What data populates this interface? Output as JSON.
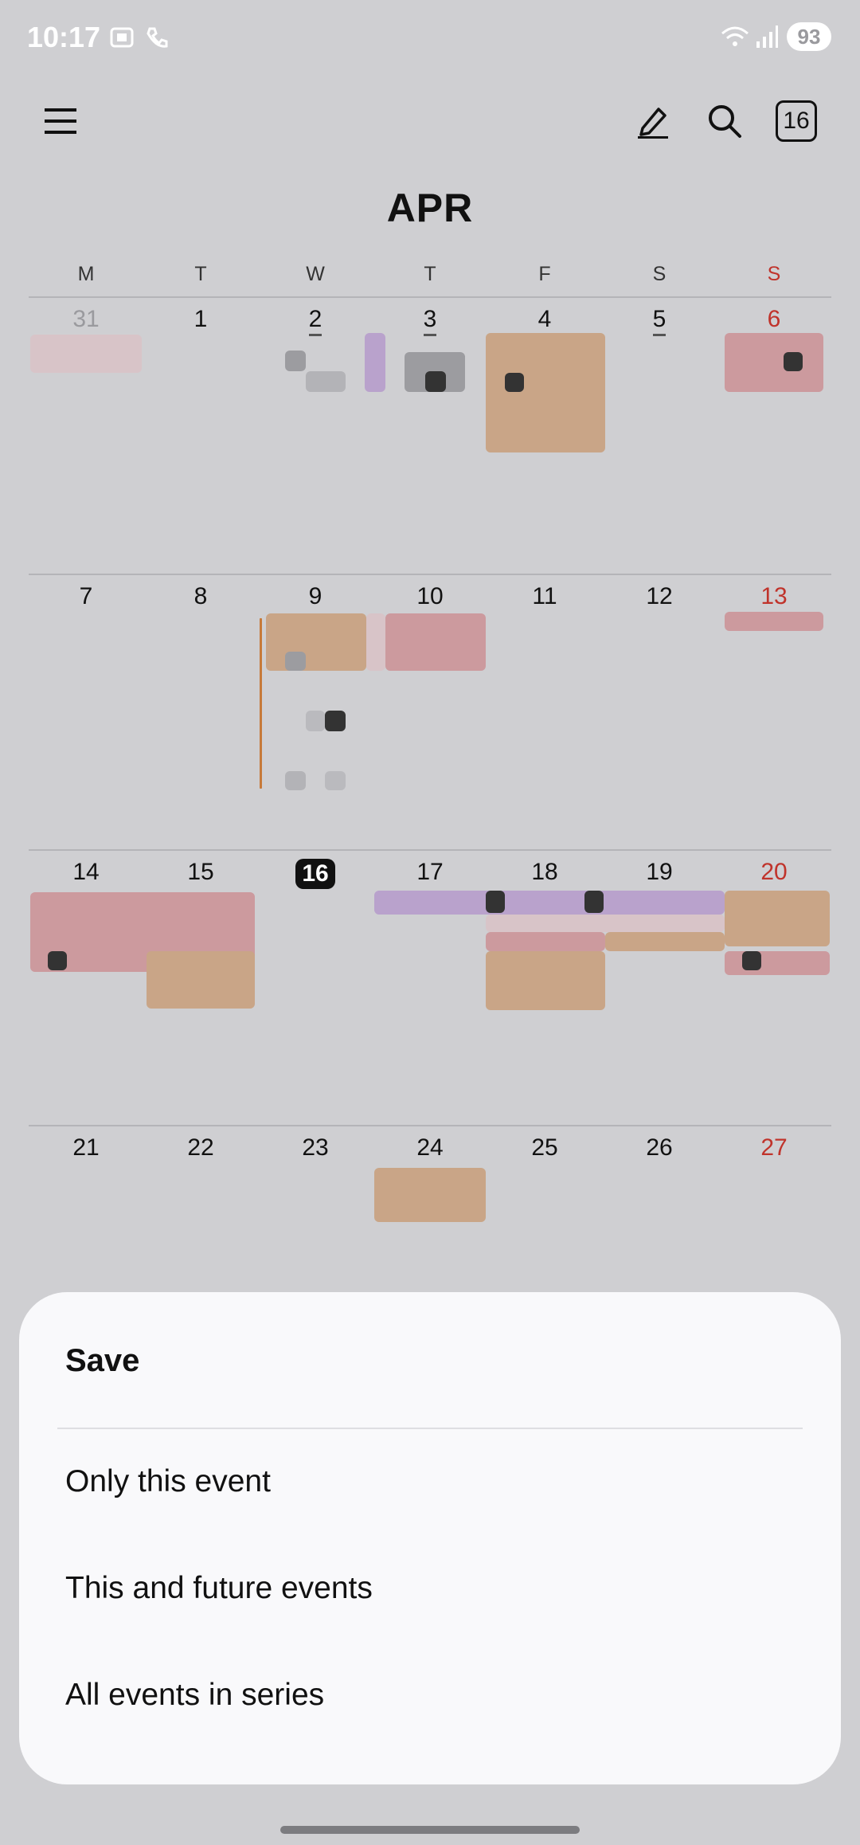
{
  "status_bar": {
    "time": "10:17",
    "battery": "93",
    "icons": [
      "screenshot-icon",
      "phone-wifi-icon",
      "wifi-icon",
      "signal-icon"
    ]
  },
  "toolbar": {
    "menu_icon": "menu-icon",
    "edit_icon": "pencil-icon",
    "search_icon": "search-icon",
    "today_label": "16"
  },
  "calendar": {
    "month": "APR",
    "weekdays": [
      "M",
      "T",
      "W",
      "T",
      "F",
      "S",
      "S"
    ],
    "weeks": [
      [
        "31",
        "1",
        "2",
        "3",
        "4",
        "5",
        "6"
      ],
      [
        "7",
        "8",
        "9",
        "10",
        "11",
        "12",
        "13"
      ],
      [
        "14",
        "15",
        "16",
        "17",
        "18",
        "19",
        "20"
      ],
      [
        "21",
        "22",
        "23",
        "24",
        "25",
        "26",
        "27"
      ]
    ],
    "today": "16",
    "colors": {
      "sunday": "#c0332b",
      "peach": "#c9a587",
      "pink": "#cc9a9e",
      "purple": "#b9a2cc"
    }
  },
  "sheet": {
    "title": "Save",
    "options": [
      "Only this event",
      "This and future events",
      "All events in series"
    ]
  }
}
